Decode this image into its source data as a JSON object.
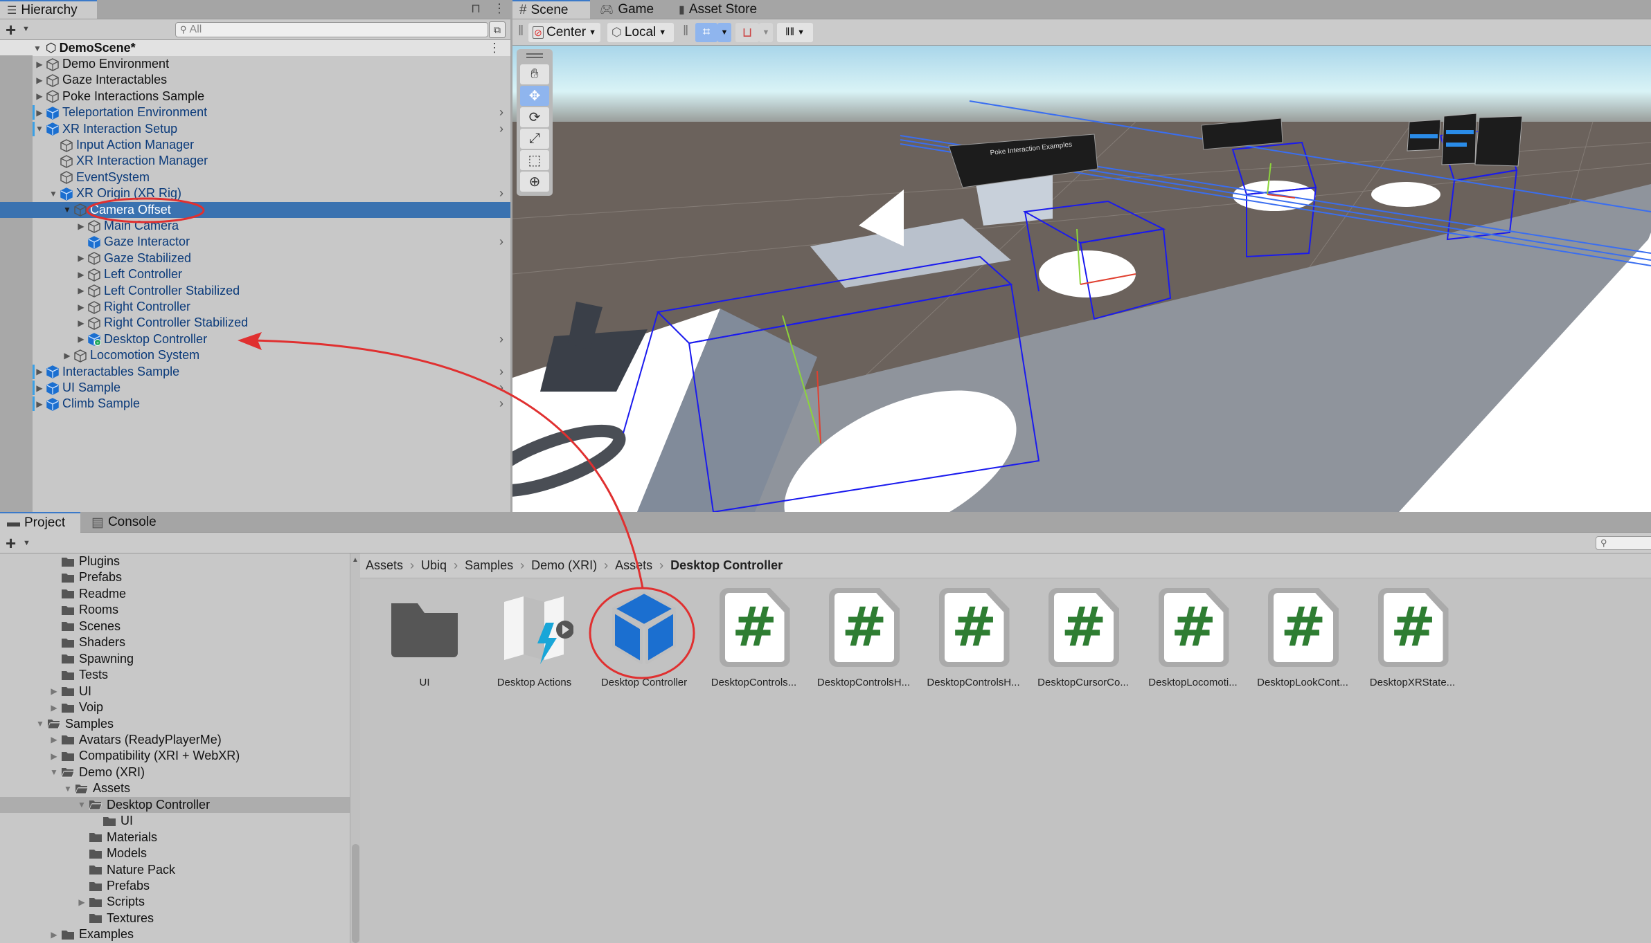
{
  "hierarchy": {
    "tab_label": "Hierarchy",
    "search_placeholder": "All",
    "scene_name": "DemoScene*",
    "items": [
      {
        "label": "Demo Environment",
        "depth": 1,
        "expand": "collapsed",
        "prefab": false
      },
      {
        "label": "Gaze Interactables",
        "depth": 1,
        "expand": "collapsed",
        "prefab": false
      },
      {
        "label": "Poke Interactions Sample",
        "depth": 1,
        "expand": "collapsed",
        "prefab": false
      },
      {
        "label": "Teleportation Environment",
        "depth": 1,
        "expand": "collapsed",
        "prefab": true
      },
      {
        "label": "XR Interaction Setup",
        "depth": 1,
        "expand": "expanded",
        "prefab": true
      },
      {
        "label": "Input Action Manager",
        "depth": 2,
        "expand": "none",
        "prefab": false
      },
      {
        "label": "XR Interaction Manager",
        "depth": 2,
        "expand": "none",
        "prefab": false
      },
      {
        "label": "EventSystem",
        "depth": 2,
        "expand": "none",
        "prefab": false
      },
      {
        "label": "XR Origin (XR Rig)",
        "depth": 2,
        "expand": "expanded",
        "prefab": true
      },
      {
        "label": "Camera Offset",
        "depth": 3,
        "expand": "expanded",
        "prefab": false,
        "selected": true
      },
      {
        "label": "Main Camera",
        "depth": 4,
        "expand": "collapsed",
        "prefab": false
      },
      {
        "label": "Gaze Interactor",
        "depth": 4,
        "expand": "none",
        "prefab": true
      },
      {
        "label": "Gaze Stabilized",
        "depth": 4,
        "expand": "collapsed",
        "prefab": false
      },
      {
        "label": "Left Controller",
        "depth": 4,
        "expand": "collapsed",
        "prefab": false
      },
      {
        "label": "Left Controller Stabilized",
        "depth": 4,
        "expand": "collapsed",
        "prefab": false
      },
      {
        "label": "Right Controller",
        "depth": 4,
        "expand": "collapsed",
        "prefab": false
      },
      {
        "label": "Right Controller Stabilized",
        "depth": 4,
        "expand": "collapsed",
        "prefab": false
      },
      {
        "label": "Desktop Controller",
        "depth": 4,
        "expand": "collapsed",
        "prefab": true,
        "added": true
      },
      {
        "label": "Locomotion System",
        "depth": 3,
        "expand": "collapsed",
        "prefab": false
      },
      {
        "label": "Interactables Sample",
        "depth": 1,
        "expand": "collapsed",
        "prefab": true
      },
      {
        "label": "UI Sample",
        "depth": 1,
        "expand": "collapsed",
        "prefab": true
      },
      {
        "label": "Climb Sample",
        "depth": 1,
        "expand": "collapsed",
        "prefab": true
      }
    ]
  },
  "scene_view": {
    "tabs": [
      {
        "label": "Scene",
        "icon": "hash-icon",
        "active": true
      },
      {
        "label": "Game",
        "icon": "gamepad-icon",
        "active": false
      },
      {
        "label": "Asset Store",
        "icon": "bag-icon",
        "active": false
      }
    ],
    "pivot_mode": "Center",
    "pivot_rotation": "Local",
    "tools": [
      "hand-icon",
      "move-icon",
      "rotate-icon",
      "scale-icon",
      "rect-icon",
      "transform-icon"
    ],
    "active_tool": "move-icon",
    "panel_titles": [
      "Poke Interaction Examples"
    ]
  },
  "project": {
    "tabs": [
      {
        "label": "Project",
        "icon": "folder-icon",
        "active": true
      },
      {
        "label": "Console",
        "icon": "console-icon",
        "active": false
      }
    ],
    "tree": [
      {
        "label": "Plugins",
        "depth": 2,
        "expand": "none",
        "open": false
      },
      {
        "label": "Prefabs",
        "depth": 2,
        "expand": "none",
        "open": false
      },
      {
        "label": "Readme",
        "depth": 2,
        "expand": "none",
        "open": false
      },
      {
        "label": "Rooms",
        "depth": 2,
        "expand": "none",
        "open": false
      },
      {
        "label": "Scenes",
        "depth": 2,
        "expand": "none",
        "open": false
      },
      {
        "label": "Shaders",
        "depth": 2,
        "expand": "none",
        "open": false
      },
      {
        "label": "Spawning",
        "depth": 2,
        "expand": "none",
        "open": false
      },
      {
        "label": "Tests",
        "depth": 2,
        "expand": "none",
        "open": false
      },
      {
        "label": "UI",
        "depth": 2,
        "expand": "collapsed",
        "open": false
      },
      {
        "label": "Voip",
        "depth": 2,
        "expand": "collapsed",
        "open": false
      },
      {
        "label": "Samples",
        "depth": 1,
        "expand": "expanded",
        "open": true
      },
      {
        "label": "Avatars (ReadyPlayerMe)",
        "depth": 2,
        "expand": "collapsed",
        "open": false
      },
      {
        "label": "Compatibility (XRI + WebXR)",
        "depth": 2,
        "expand": "collapsed",
        "open": false
      },
      {
        "label": "Demo (XRI)",
        "depth": 2,
        "expand": "expanded",
        "open": true
      },
      {
        "label": "Assets",
        "depth": 3,
        "expand": "expanded",
        "open": true
      },
      {
        "label": "Desktop Controller",
        "depth": 4,
        "expand": "expanded",
        "open": true,
        "selected": true
      },
      {
        "label": "UI",
        "depth": 5,
        "expand": "none",
        "open": false
      },
      {
        "label": "Materials",
        "depth": 4,
        "expand": "none",
        "open": false
      },
      {
        "label": "Models",
        "depth": 4,
        "expand": "none",
        "open": false
      },
      {
        "label": "Nature Pack",
        "depth": 4,
        "expand": "none",
        "open": false
      },
      {
        "label": "Prefabs",
        "depth": 4,
        "expand": "none",
        "open": false
      },
      {
        "label": "Scripts",
        "depth": 4,
        "expand": "collapsed",
        "open": false
      },
      {
        "label": "Textures",
        "depth": 4,
        "expand": "none",
        "open": false
      },
      {
        "label": "Examples",
        "depth": 2,
        "expand": "collapsed",
        "open": false
      }
    ],
    "breadcrumb": [
      "Assets",
      "Ubiq",
      "Samples",
      "Demo (XRI)",
      "Assets",
      "Desktop Controller"
    ],
    "assets": [
      {
        "label": "UI",
        "type": "folder"
      },
      {
        "label": "Desktop Actions",
        "type": "input-actions"
      },
      {
        "label": "Desktop Controller",
        "type": "prefab",
        "highlighted": true
      },
      {
        "label": "DesktopControls...",
        "type": "script"
      },
      {
        "label": "DesktopControlsH...",
        "type": "script"
      },
      {
        "label": "DesktopControlsH...",
        "type": "script"
      },
      {
        "label": "DesktopCursorCo...",
        "type": "script"
      },
      {
        "label": "DesktopLocomoti...",
        "type": "script"
      },
      {
        "label": "DesktopLookCont...",
        "type": "script"
      },
      {
        "label": "DesktopXRState...",
        "type": "script"
      }
    ],
    "script_glyph": "#",
    "tree_separator": "›"
  },
  "colors": {
    "selection": "#3a72b0",
    "prefab_blue": "#1b6fd0",
    "annotation_red": "#e03030",
    "script_green": "#2e7d32",
    "sky": "#d8f3f7",
    "ground": "#6b625c"
  },
  "symbols": {
    "expanded": "▼",
    "collapsed": "▶",
    "more": "⋮",
    "submenu": "›",
    "dropdown": "▼",
    "plus": "+"
  }
}
